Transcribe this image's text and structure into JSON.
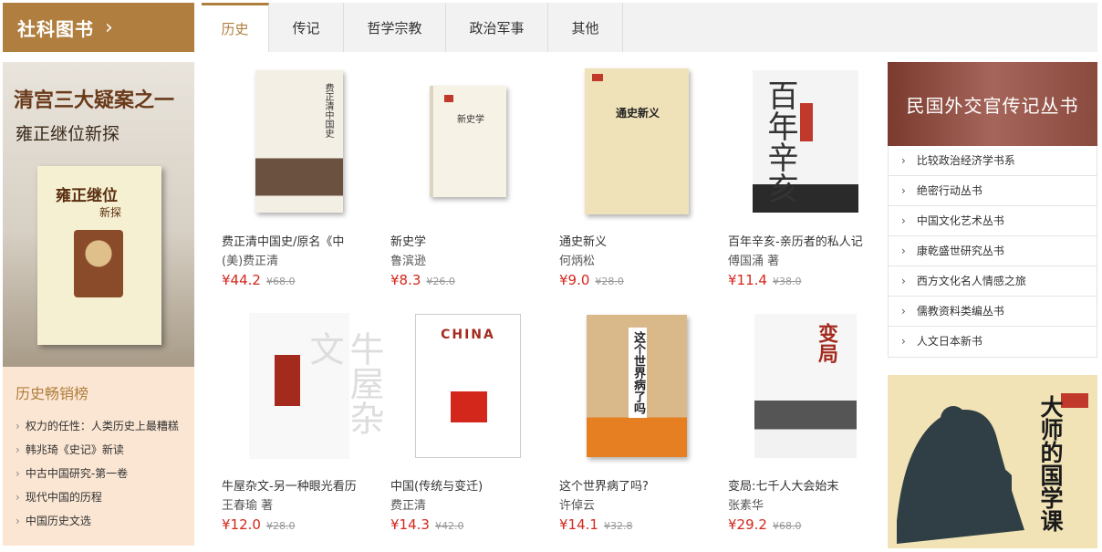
{
  "header": {
    "category_title": "社科图书",
    "chevron": "›",
    "tabs": [
      {
        "label": "历史",
        "active": true
      },
      {
        "label": "传记",
        "active": false
      },
      {
        "label": "哲学宗教",
        "active": false
      },
      {
        "label": "政治军事",
        "active": false
      },
      {
        "label": "其他",
        "active": false
      }
    ]
  },
  "left_banner": {
    "line1": "清宫三大疑案之一",
    "line2": "雍正继位新探",
    "cover_title": "雍正继位",
    "cover_subtitle": "新探"
  },
  "bestseller": {
    "title": "历史畅销榜",
    "items": [
      "权力的任性：人类历史上最糟糕",
      "韩兆琦《史记》新读",
      "中古中国研究-第一卷",
      "现代中国的历程",
      "中国历史文选"
    ]
  },
  "books": [
    {
      "title": "费正清中国史/原名《中",
      "author": "(美)费正清",
      "price": "¥44.2",
      "old_price": "¥68.0",
      "cover_text": "费正清中国史"
    },
    {
      "title": "新史学",
      "author": "鲁滨逊",
      "price": "¥8.3",
      "old_price": "¥26.0",
      "cover_text": "新史学"
    },
    {
      "title": "通史新义",
      "author": "何炳松",
      "price": "¥9.0",
      "old_price": "¥28.0",
      "cover_text": "通史新义"
    },
    {
      "title": "百年辛亥-亲历者的私人记",
      "author": "傅国涌 著",
      "price": "¥11.4",
      "old_price": "¥38.0",
      "cover_text": "百年辛亥"
    },
    {
      "title": "牛屋杂文-另一种眼光看历",
      "author": "王春瑜 著",
      "price": "¥12.0",
      "old_price": "¥28.0",
      "cover_text": "牛屋杂文"
    },
    {
      "title": "中国(传统与变迁)",
      "author": "费正清",
      "price": "¥14.3",
      "old_price": "¥42.0",
      "cover_text": "CHINA"
    },
    {
      "title": "这个世界病了吗?",
      "author": "许倬云",
      "price": "¥14.1",
      "old_price": "¥32.8",
      "cover_text": "这个世界病了吗"
    },
    {
      "title": "变局:七千人大会始末",
      "author": "张素华",
      "price": "¥29.2",
      "old_price": "¥68.0",
      "cover_text": "变局"
    }
  ],
  "right_banner": {
    "title": "民国外交官传记丛书"
  },
  "series": [
    "比较政治经济学书系",
    "绝密行动丛书",
    "中国文化艺术丛书",
    "康乾盛世研究丛书",
    "西方文化名人情感之旅",
    "儒教资料类编丛书",
    "人文日本新书"
  ],
  "master_banner": {
    "title": "大师的国学课"
  },
  "icons": {
    "list_arrow": "›"
  },
  "colors": {
    "accent": "#b07e3e",
    "price": "#d4271b",
    "bestseller_bg": "#fbe6d3"
  }
}
